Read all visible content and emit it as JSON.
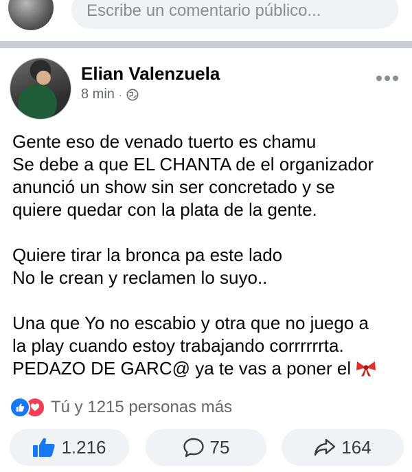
{
  "comment_bar": {
    "placeholder": "Escribe un comentario público..."
  },
  "post": {
    "author": "Elian Valenzuela",
    "time": "8 min",
    "separator": "·",
    "privacy_icon": "globe-icon",
    "menu_icon": "more-horizontal-icon",
    "body": [
      [
        "Gente eso de venado tuerto es chamu",
        "Se debe a que EL CHANTA de el organizador",
        "anunció un show sin ser concretado y se",
        "quiere quedar con la plata de la gente."
      ],
      [
        "Quiere tirar la bronca pa este lado",
        "No le crean y reclamen lo suyo.."
      ],
      [
        "Una que Yo no escabio y otra que no juego a",
        "la play cuando estoy trabajando corrrrrrta.",
        "PEDAZO DE GARC@ ya te vas a poner el"
      ]
    ],
    "emoji": "ribbon-bow-icon"
  },
  "reactions": {
    "text": "Tú y 1215 personas más",
    "icons": [
      "like-icon",
      "love-icon"
    ]
  },
  "actions": {
    "like_count": "1.216",
    "comment_count": "75",
    "share_count": "164"
  },
  "colors": {
    "brand_blue": "#1877f2",
    "love_red": "#f33e58",
    "bg_pill": "#f0f2f5",
    "muted": "#65676b"
  }
}
